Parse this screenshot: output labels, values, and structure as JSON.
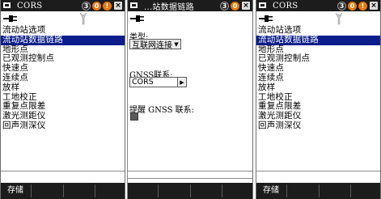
{
  "panels": {
    "left": {
      "title": "CORS",
      "softkey": "存储",
      "items": [
        {
          "label": "流动站选项",
          "selected": false
        },
        {
          "label": "流动站数据链路",
          "selected": true
        },
        {
          "label": "地形点",
          "selected": false
        },
        {
          "label": "已观测控制点",
          "selected": false
        },
        {
          "label": "快速点",
          "selected": false
        },
        {
          "label": "连续点",
          "selected": false
        },
        {
          "label": "放样",
          "selected": false
        },
        {
          "label": "工地校正",
          "selected": false
        },
        {
          "label": "重复点限差",
          "selected": false
        },
        {
          "label": "激光测距仪",
          "selected": false
        },
        {
          "label": "回声测深仪",
          "selected": false
        }
      ]
    },
    "middle": {
      "title": "...站数据链路",
      "type_label": "类型:",
      "type_value": "互联网连接",
      "gnss_label": "GNSS联系:",
      "gnss_value": "CORS",
      "prompt_label": "提醒 GNSS 联系:"
    },
    "right": {
      "title": "CORS",
      "softkey": "存储",
      "items": [
        {
          "label": "流动站选项",
          "selected": false
        },
        {
          "label": "流动站数据链路",
          "selected": true
        },
        {
          "label": "地形点",
          "selected": false
        },
        {
          "label": "已观测控制点",
          "selected": false
        },
        {
          "label": "快速点",
          "selected": false
        },
        {
          "label": "连续点",
          "selected": false
        },
        {
          "label": "放样",
          "selected": false
        },
        {
          "label": "工地校正",
          "selected": false
        },
        {
          "label": "重复点限差",
          "selected": false
        },
        {
          "label": "激光测距仪",
          "selected": false
        },
        {
          "label": "回声测深仪",
          "selected": false
        }
      ]
    }
  },
  "titlebar_buttons": {
    "b1": "3",
    "b2": "0",
    "b3": "!",
    "close": "×"
  },
  "colors": {
    "selection": "#0b1d8c",
    "orange": "#e8780c",
    "bar": "#1c1c1c"
  }
}
